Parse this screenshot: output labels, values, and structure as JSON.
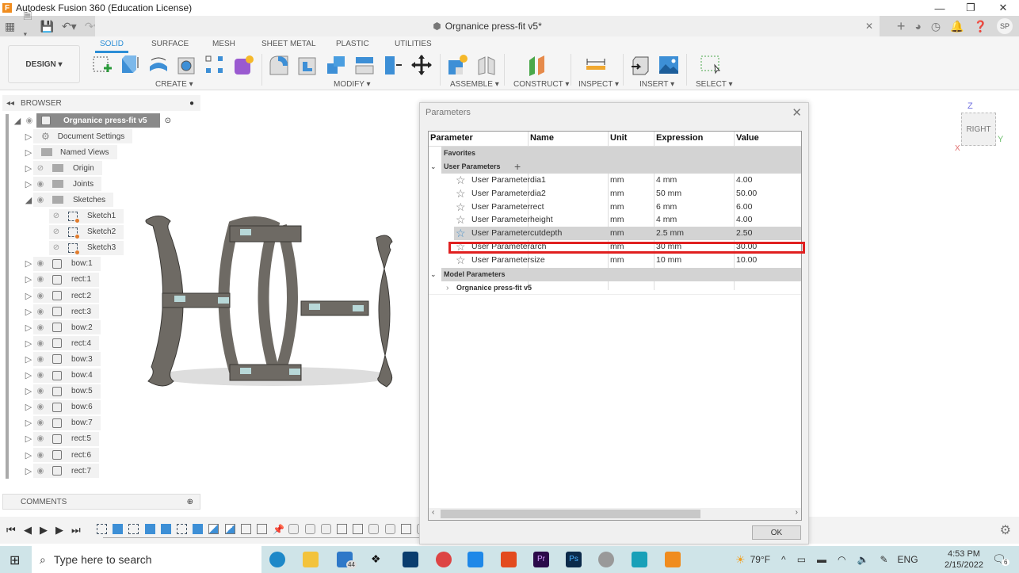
{
  "window": {
    "title": "Autodesk Fusion 360 (Education License)",
    "app_icon": "F"
  },
  "appbar": {
    "doc_tab": "Orgnanice press-fit v5*",
    "user_initials": "SP"
  },
  "ribbon": {
    "workspace": "DESIGN",
    "tabs": [
      "SOLID",
      "SURFACE",
      "MESH",
      "SHEET METAL",
      "PLASTIC",
      "UTILITIES"
    ],
    "active_tab": "SOLID",
    "groups": [
      "CREATE",
      "MODIFY",
      "ASSEMBLE",
      "CONSTRUCT",
      "INSPECT",
      "INSERT",
      "SELECT"
    ]
  },
  "browser": {
    "header": "BROWSER",
    "root": "Orgnanice press-fit v5",
    "items": [
      {
        "label": "Document Settings",
        "type": "settings"
      },
      {
        "label": "Named Views",
        "type": "folder"
      },
      {
        "label": "Origin",
        "type": "folder"
      },
      {
        "label": "Joints",
        "type": "folder"
      },
      {
        "label": "Sketches",
        "type": "folder"
      },
      {
        "label": "Sketch1",
        "type": "sketch"
      },
      {
        "label": "Sketch2",
        "type": "sketch"
      },
      {
        "label": "Sketch3",
        "type": "sketch"
      },
      {
        "label": "bow:1",
        "type": "body"
      },
      {
        "label": "rect:1",
        "type": "body"
      },
      {
        "label": "rect:2",
        "type": "body"
      },
      {
        "label": "rect:3",
        "type": "body"
      },
      {
        "label": "bow:2",
        "type": "body"
      },
      {
        "label": "rect:4",
        "type": "body"
      },
      {
        "label": "bow:3",
        "type": "body"
      },
      {
        "label": "bow:4",
        "type": "body"
      },
      {
        "label": "bow:5",
        "type": "body"
      },
      {
        "label": "bow:6",
        "type": "body"
      },
      {
        "label": "bow:7",
        "type": "body"
      },
      {
        "label": "rect:5",
        "type": "body"
      },
      {
        "label": "rect:6",
        "type": "body"
      },
      {
        "label": "rect:7",
        "type": "body"
      }
    ]
  },
  "comments": {
    "header": "COMMENTS"
  },
  "viewcube": {
    "face": "RIGHT",
    "axes": [
      "Z",
      "Y",
      "X"
    ]
  },
  "dialog": {
    "title": "Parameters",
    "columns": [
      "Parameter",
      "Name",
      "Unit",
      "Expression",
      "Value"
    ],
    "groups": {
      "favorites": "Favorites",
      "user": "User Parameters",
      "model": "Model Parameters"
    },
    "user_params": [
      {
        "type": "User Parameter",
        "name": "dia1",
        "unit": "mm",
        "expression": "4 mm",
        "value": "4.00"
      },
      {
        "type": "User Parameter",
        "name": "dia2",
        "unit": "mm",
        "expression": "50 mm",
        "value": "50.00"
      },
      {
        "type": "User Parameter",
        "name": "rect",
        "unit": "mm",
        "expression": "6 mm",
        "value": "6.00"
      },
      {
        "type": "User Parameter",
        "name": "height",
        "unit": "mm",
        "expression": "4 mm",
        "value": "4.00"
      },
      {
        "type": "User Parameter",
        "name": "cutdepth",
        "unit": "mm",
        "expression": "2.5 mm",
        "value": "2.50"
      },
      {
        "type": "User Parameter",
        "name": "arch",
        "unit": "mm",
        "expression": "30 mm",
        "value": "30.00"
      },
      {
        "type": "User Parameter",
        "name": "size",
        "unit": "mm",
        "expression": "10 mm",
        "value": "10.00"
      }
    ],
    "highlighted_param": "height",
    "selected_param": "cutdepth",
    "model_item": "Orgnanice press-fit v5",
    "ok_label": "OK"
  },
  "taskbar": {
    "search_placeholder": "Type here to search",
    "mail_badge": "44",
    "weather": "79°F",
    "language": "ENG",
    "time": "4:53 PM",
    "date": "2/15/2022",
    "notifications": "6"
  }
}
